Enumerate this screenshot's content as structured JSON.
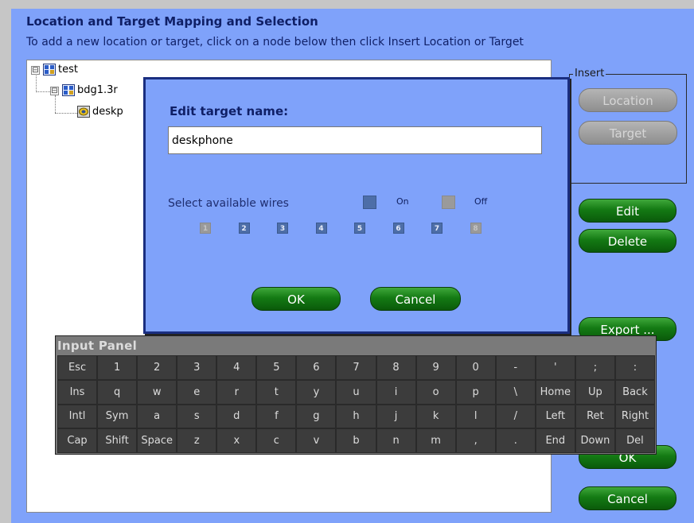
{
  "page": {
    "heading": "Location and Target Mapping and Selection",
    "instructions": "To add a new location or target, click on a node below then click Insert Location or Target"
  },
  "tree": {
    "root_label": "test",
    "child_label": "bdg1.3r",
    "grandchild_label": "deskp",
    "expander_symbol": "⊟"
  },
  "insert": {
    "legend": "Insert",
    "location_label": "Location",
    "target_label": "Target"
  },
  "actions": {
    "edit_label": "Edit",
    "delete_label": "Delete",
    "export_label": "Export ...",
    "ok_label": "OK",
    "cancel_label": "Cancel"
  },
  "dialog": {
    "title": "Edit target name:",
    "name_value": "deskphone",
    "wires_label": "Select available wires",
    "legend_on": "On",
    "legend_off": "Off",
    "wires": [
      {
        "label": "1",
        "on": false
      },
      {
        "label": "2",
        "on": true
      },
      {
        "label": "3",
        "on": true
      },
      {
        "label": "4",
        "on": true
      },
      {
        "label": "5",
        "on": true
      },
      {
        "label": "6",
        "on": true
      },
      {
        "label": "7",
        "on": true
      },
      {
        "label": "8",
        "on": false
      }
    ],
    "ok_label": "OK",
    "cancel_label": "Cancel"
  },
  "input_panel": {
    "title": "Input Panel",
    "rows": [
      [
        "Esc",
        "1",
        "2",
        "3",
        "4",
        "5",
        "6",
        "7",
        "8",
        "9",
        "0",
        "-",
        "'",
        ";",
        ":"
      ],
      [
        "Ins",
        "q",
        "w",
        "e",
        "r",
        "t",
        "y",
        "u",
        "i",
        "o",
        "p",
        "\\",
        "Home",
        "Up",
        "Back"
      ],
      [
        "Intl",
        "Sym",
        "a",
        "s",
        "d",
        "f",
        "g",
        "h",
        "j",
        "k",
        "l",
        "/",
        "Left",
        "Ret",
        "Right"
      ],
      [
        "Cap",
        "Shift",
        "Space",
        "z",
        "x",
        "c",
        "v",
        "b",
        "n",
        "m",
        ",",
        ".",
        "End",
        "Down",
        "Del"
      ]
    ]
  },
  "colors": {
    "panel_bg": "#7fa2fa",
    "heading_text": "#0f1f66",
    "button_green": "#147a14",
    "button_gray": "#9a9a9a",
    "wire_on": "#4d6ea8",
    "wire_off": "#9a9a9a",
    "keyboard_bg": "#3c3c3c"
  }
}
